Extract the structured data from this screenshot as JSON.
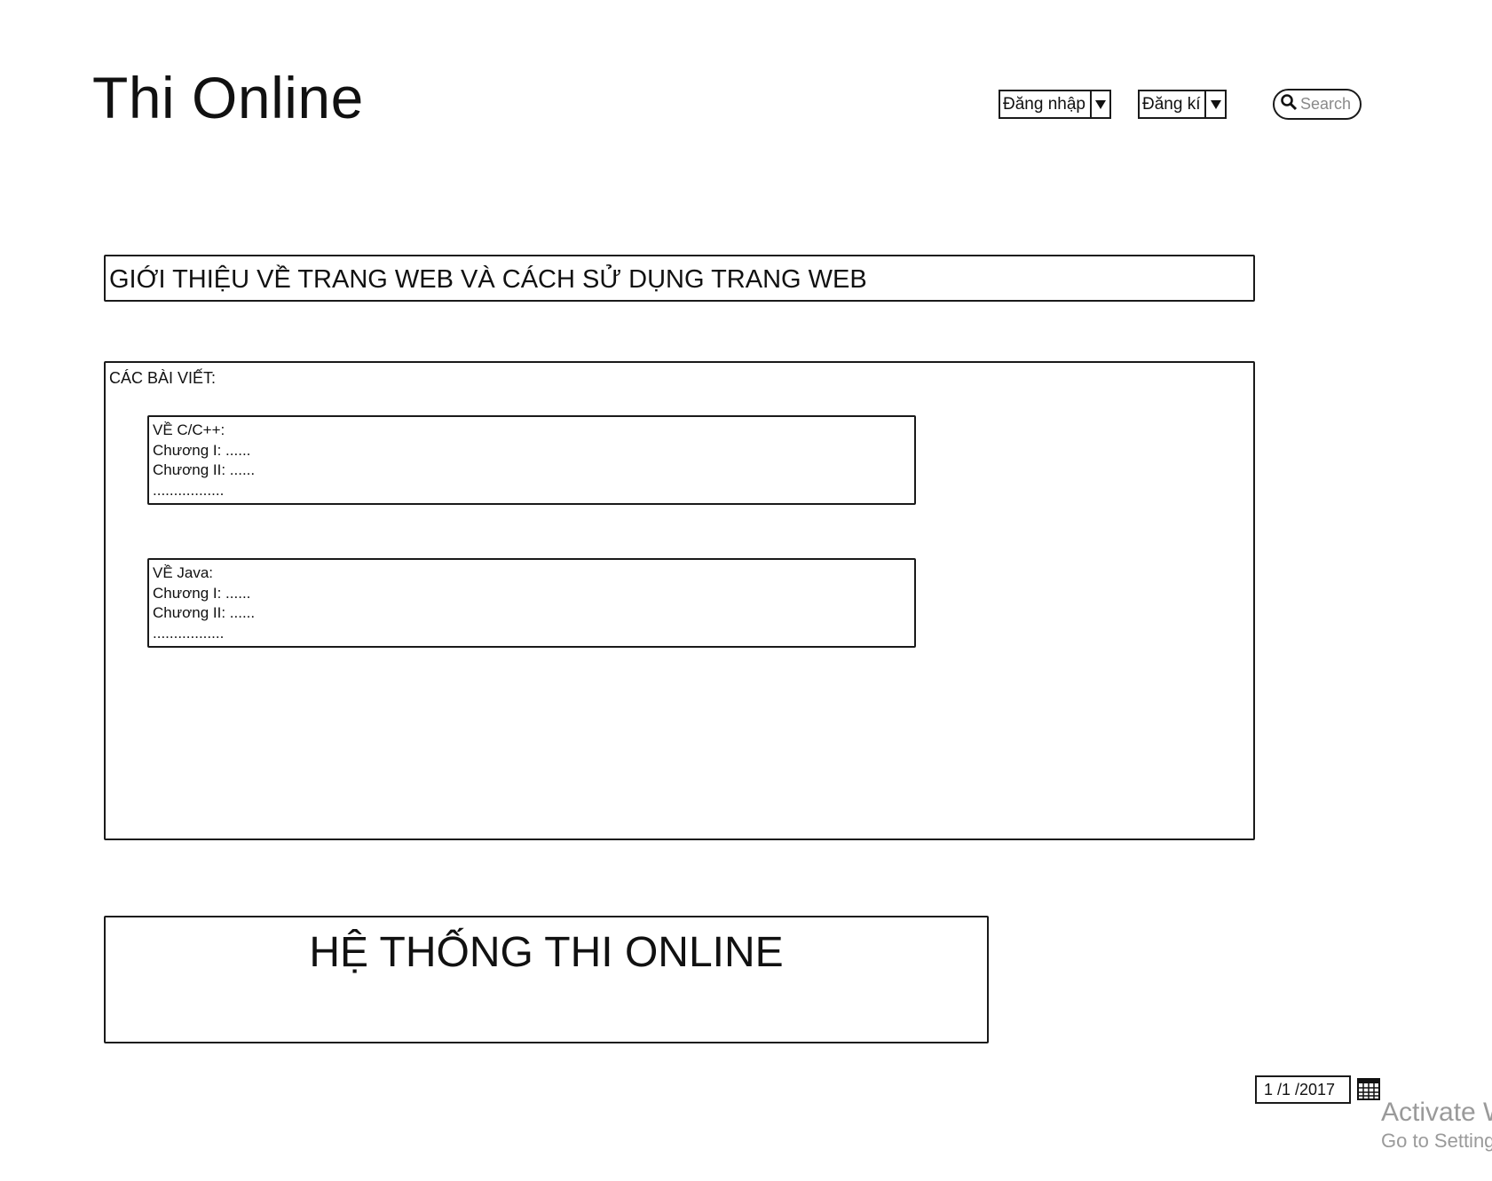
{
  "header": {
    "title": "Thi Online",
    "login_label": "Đăng nhập",
    "register_label": "Đăng kí",
    "search_placeholder": "Search"
  },
  "intro": {
    "text": "GIỚI THIỆU VỀ TRANG WEB VÀ CÁCH SỬ DỤNG TRANG WEB"
  },
  "posts": {
    "heading": "CÁC BÀI VIẾT:",
    "items": [
      {
        "title": "VỀ C/C++:",
        "lines": [
          "Chương I: ......",
          "Chương II: ......",
          "................."
        ]
      },
      {
        "title": "VỀ Java:",
        "lines": [
          "Chương I: ......",
          "Chương II: ......",
          "................."
        ]
      }
    ]
  },
  "footer": {
    "banner_text": "HỆ THỐNG THI ONLINE"
  },
  "date_picker": {
    "value": "1 /1 /2017"
  },
  "watermark": {
    "line1": "Activate W",
    "line2": "Go to Setting"
  },
  "icons": {
    "dropdown_arrow": "chevron-down-icon",
    "search": "search-icon",
    "calendar": "calendar-icon"
  }
}
